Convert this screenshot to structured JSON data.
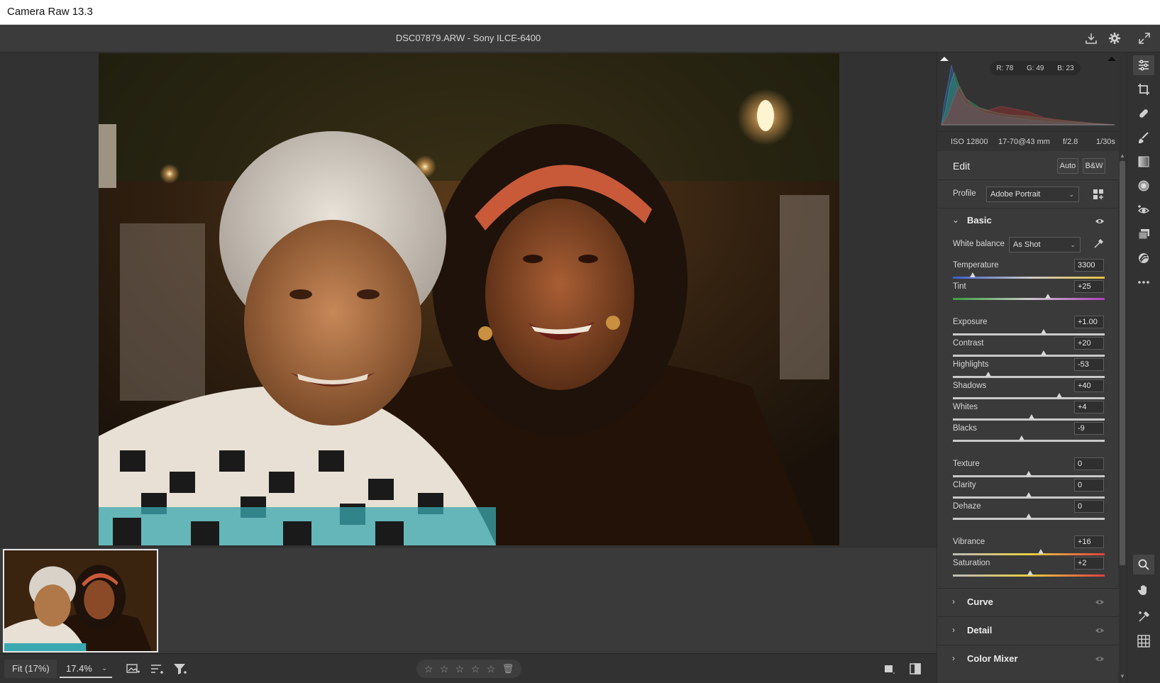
{
  "window": {
    "title": "Camera Raw 13.3"
  },
  "header": {
    "file_info": "DSC07879.ARW  -  Sony ILCE-6400"
  },
  "histogram": {
    "r": "R: 78",
    "g": "G: 49",
    "b": "B: 23"
  },
  "exif": {
    "iso": "ISO 12800",
    "lens": "17-70@43 mm",
    "aperture": "f/2.8",
    "shutter": "1/30s"
  },
  "edit": {
    "title": "Edit",
    "auto_label": "Auto",
    "bw_label": "B&W",
    "profile_label": "Profile",
    "profile_value": "Adobe Portrait"
  },
  "basic": {
    "title": "Basic",
    "wb_label": "White balance",
    "wb_value": "As Shot",
    "sliders": [
      {
        "label": "Temperature",
        "value": "3300",
        "pos": 0.13,
        "track": "temp"
      },
      {
        "label": "Tint",
        "value": "+25",
        "pos": 0.625,
        "track": "tint"
      },
      {
        "label": "Exposure",
        "value": "+1.00",
        "pos": 0.6,
        "track": "gray"
      },
      {
        "label": "Contrast",
        "value": "+20",
        "pos": 0.6,
        "track": "gray"
      },
      {
        "label": "Highlights",
        "value": "-53",
        "pos": 0.235,
        "track": "gray"
      },
      {
        "label": "Shadows",
        "value": "+40",
        "pos": 0.7,
        "track": "gray"
      },
      {
        "label": "Whites",
        "value": "+4",
        "pos": 0.52,
        "track": "gray"
      },
      {
        "label": "Blacks",
        "value": "-9",
        "pos": 0.455,
        "track": "gray"
      },
      {
        "label": "Texture",
        "value": "0",
        "pos": 0.5,
        "track": "gray"
      },
      {
        "label": "Clarity",
        "value": "0",
        "pos": 0.5,
        "track": "gray"
      },
      {
        "label": "Dehaze",
        "value": "0",
        "pos": 0.5,
        "track": "gray"
      },
      {
        "label": "Vibrance",
        "value": "+16",
        "pos": 0.58,
        "track": "vib"
      },
      {
        "label": "Saturation",
        "value": "+2",
        "pos": 0.51,
        "track": "vib"
      }
    ]
  },
  "panels": [
    {
      "name": "Curve"
    },
    {
      "name": "Detail"
    },
    {
      "name": "Color Mixer"
    }
  ],
  "bottombar": {
    "fit_label": "Fit (17%)",
    "zoom_value": "17.4%"
  },
  "colors": {
    "panel_bg": "#3a3a3a",
    "canvas_bg": "#323232",
    "accent": "#ffffff"
  }
}
